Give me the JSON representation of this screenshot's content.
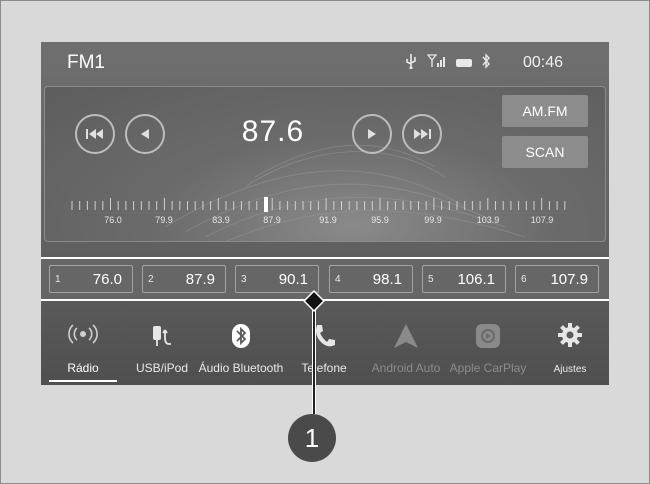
{
  "status_bar": {
    "band": "FM1",
    "icons": [
      "usb-icon",
      "signal-icon",
      "battery-icon",
      "bluetooth-icon"
    ],
    "clock": "00:46"
  },
  "tuner": {
    "frequency": "87.6",
    "buttons": {
      "am_fm": "AM.FM",
      "scan": "SCAN"
    },
    "scale_labels": [
      "76.0",
      "79.9",
      "83.9",
      "87.9",
      "91.9",
      "95.9",
      "99.9",
      "103.9",
      "107.9"
    ]
  },
  "presets": [
    {
      "num": "1",
      "freq": "76.0"
    },
    {
      "num": "2",
      "freq": "87.9"
    },
    {
      "num": "3",
      "freq": "90.1"
    },
    {
      "num": "4",
      "freq": "98.1"
    },
    {
      "num": "5",
      "freq": "106.1"
    },
    {
      "num": "6",
      "freq": "107.9"
    }
  ],
  "nav": [
    {
      "label": "Rádio",
      "icon": "radio-icon",
      "active": true
    },
    {
      "label": "USB/iPod",
      "icon": "usb-ipod-icon"
    },
    {
      "label": "Áudio Bluetooth",
      "icon": "bluetooth-icon"
    },
    {
      "label": "Telefone",
      "icon": "phone-icon"
    },
    {
      "label": "Android Auto",
      "icon": "android-auto-icon",
      "dim": true
    },
    {
      "label": "Apple CarPlay",
      "icon": "carplay-icon",
      "dim": true
    },
    {
      "label": "Ajustes",
      "icon": "gear-icon"
    }
  ],
  "callout": {
    "number": "1"
  },
  "colors": {
    "screen": "#666666",
    "frame": "#d9d9d9",
    "highlight": "#ffffff",
    "callout": "#4a4a4a"
  }
}
